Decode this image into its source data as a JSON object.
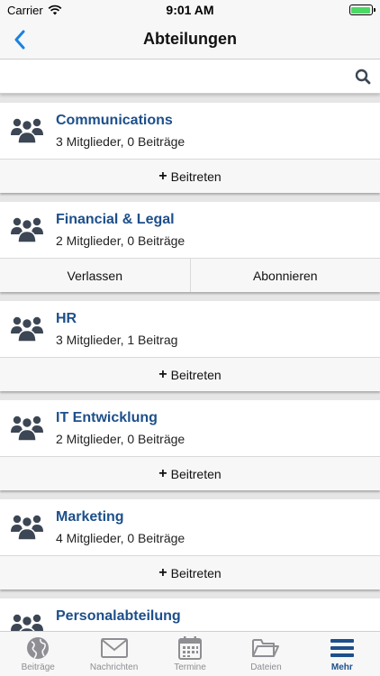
{
  "status": {
    "carrier": "Carrier",
    "time": "9:01 AM"
  },
  "nav": {
    "title": "Abteilungen"
  },
  "search": {
    "placeholder": ""
  },
  "departments": [
    {
      "name": "Communications",
      "meta": "3 Mitglieder, 0 Beiträge",
      "actions": [
        "Beitreten"
      ]
    },
    {
      "name": "Financial & Legal",
      "meta": "2 Mitglieder, 0 Beiträge",
      "actions": [
        "Verlassen",
        "Abonnieren"
      ]
    },
    {
      "name": "HR",
      "meta": "3 Mitglieder, 1 Beitrag",
      "actions": [
        "Beitreten"
      ]
    },
    {
      "name": "IT Entwicklung",
      "meta": "2 Mitglieder, 0 Beiträge",
      "actions": [
        "Beitreten"
      ]
    },
    {
      "name": "Marketing",
      "meta": "4 Mitglieder, 0 Beiträge",
      "actions": [
        "Beitreten"
      ]
    },
    {
      "name": "Personalabteilung",
      "meta": "",
      "actions": []
    }
  ],
  "tabs": [
    {
      "label": "Beiträge",
      "icon": "globe-icon"
    },
    {
      "label": "Nachrichten",
      "icon": "envelope-icon"
    },
    {
      "label": "Termine",
      "icon": "calendar-icon"
    },
    {
      "label": "Dateien",
      "icon": "folder-icon"
    },
    {
      "label": "Mehr",
      "icon": "menu-icon"
    }
  ],
  "colors": {
    "accent": "#1d4f8a",
    "link_blue": "#1a82e2",
    "icon_gray": "#3c4654",
    "tab_gray": "#8e8e93"
  }
}
